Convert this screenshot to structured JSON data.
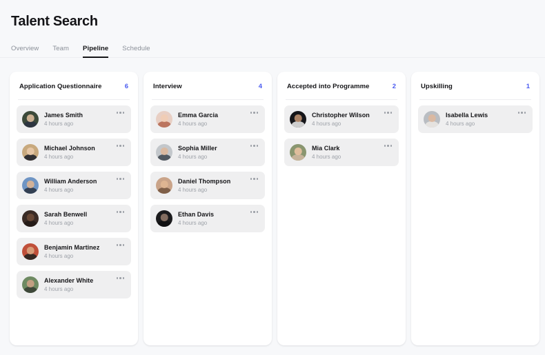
{
  "header": {
    "title": "Talent Search",
    "tabs": [
      {
        "label": "Overview",
        "active": false
      },
      {
        "label": "Team",
        "active": false
      },
      {
        "label": "Pipeline",
        "active": true
      },
      {
        "label": "Schedule",
        "active": false
      }
    ]
  },
  "accent_color": "#4a5bf0",
  "board": {
    "columns": [
      {
        "title": "Application Questionnaire",
        "count": "6",
        "cards": [
          {
            "name": "James Smith",
            "time": "4 hours ago",
            "avatar": {
              "bg": "#3c4a3a",
              "face": "#d8b99a",
              "body": "#2c3440"
            }
          },
          {
            "name": "Michael Johnson",
            "time": "4 hours ago",
            "avatar": {
              "bg": "#c8a97e",
              "face": "#e8c9a8",
              "body": "#2a2a30"
            }
          },
          {
            "name": "William Anderson",
            "time": "4 hours ago",
            "avatar": {
              "bg": "#6f95c4",
              "face": "#d9b394",
              "body": "#2f3b4d"
            }
          },
          {
            "name": "Sarah Benwell",
            "time": "4 hours ago",
            "avatar": {
              "bg": "#3a2b25",
              "face": "#6b4a36",
              "body": "#241a16"
            }
          },
          {
            "name": "Benjamin Martinez",
            "time": "4 hours ago",
            "avatar": {
              "bg": "#c0503a",
              "face": "#d9a37e",
              "body": "#2e2722"
            }
          },
          {
            "name": "Alexander White",
            "time": "4 hours ago",
            "avatar": {
              "bg": "#6e8a62",
              "face": "#c9a184",
              "body": "#3b4437"
            }
          }
        ]
      },
      {
        "title": "Interview",
        "count": "4",
        "cards": [
          {
            "name": "Emma Garcia",
            "time": "4 hours ago",
            "avatar": {
              "bg": "#e8cfc4",
              "face": "#f0cdb4",
              "body": "#b8705a"
            }
          },
          {
            "name": "Sophia Miller",
            "time": "4 hours ago",
            "avatar": {
              "bg": "#c3c7cb",
              "face": "#dcb79c",
              "body": "#4b525a"
            }
          },
          {
            "name": "Daniel Thompson",
            "time": "4 hours ago",
            "avatar": {
              "bg": "#caa489",
              "face": "#e0b693",
              "body": "#7b5d46"
            }
          },
          {
            "name": "Ethan Davis",
            "time": "4 hours ago",
            "avatar": {
              "bg": "#1b1b1d",
              "face": "#8c7466",
              "body": "#101012"
            }
          }
        ]
      },
      {
        "title": "Accepted into Programme",
        "count": "2",
        "cards": [
          {
            "name": "Christopher Wilson",
            "time": "4 hours ago",
            "avatar": {
              "bg": "#16161a",
              "face": "#b98d6e",
              "body": "#d8d8d8"
            }
          },
          {
            "name": "Mia Clark",
            "time": "4 hours ago",
            "avatar": {
              "bg": "#8a9670",
              "face": "#e6c0a0",
              "body": "#c9b49c"
            }
          }
        ]
      },
      {
        "title": "Upskilling",
        "count": "1",
        "cards": [
          {
            "name": "Isabella Lewis",
            "time": "4 hours ago",
            "avatar": {
              "bg": "#b9bdc2",
              "face": "#dcb9a0",
              "body": "#e7e4e0"
            }
          }
        ]
      }
    ]
  }
}
